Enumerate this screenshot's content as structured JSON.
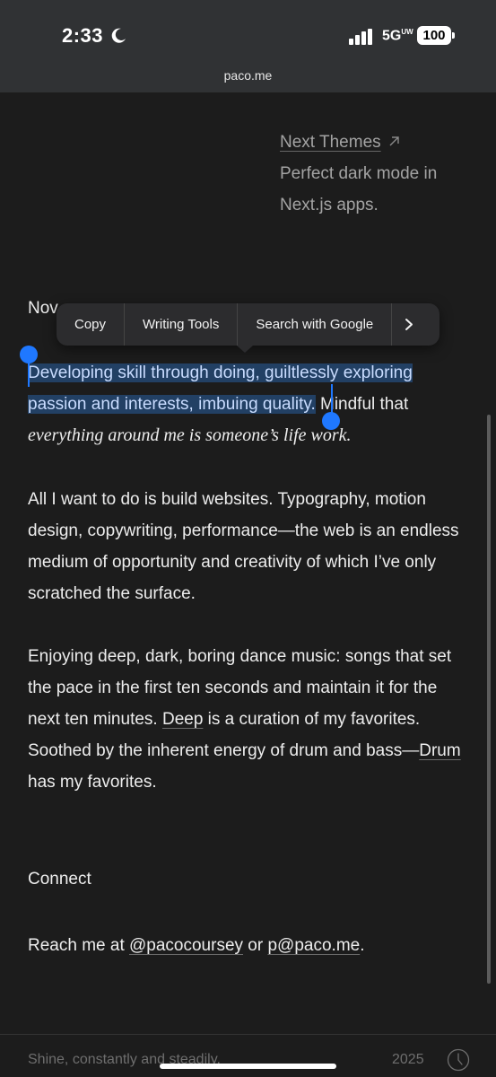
{
  "status_bar": {
    "time": "2:33",
    "network": "5G",
    "network_superscript": "UW",
    "battery": "100"
  },
  "browser": {
    "url": "paco.me"
  },
  "project": {
    "link": "Next Themes",
    "desc_line1": "Perfect dark mode in",
    "desc_line2": "Next.js apps."
  },
  "now": {
    "heading": "Nov",
    "para1": {
      "selected_line1": "Developing skill through doing, guiltlessly exploring",
      "selected_line2": "passion and interests, imbuing quality.",
      "rest_line2": " Mindful that",
      "italic_line3": "everything around me is someone’s life work."
    },
    "para2": "All I want to do is build websites. Typography, motion design, copywriting, performance—the web is an endless medium of opportunity and creativity of which I’ve only scratched the surface.",
    "para3": {
      "text1": "Enjoying deep, dark, boring dance music: songs that set the pace in the first ten seconds and maintain it for the next ten minutes. ",
      "link_deep": "Deep",
      "text2": " is a curation of my favorites. Soothed by the inherent energy of drum and bass—",
      "link_drum": "Drum",
      "text3": " has my favorites."
    }
  },
  "context_menu": {
    "copy": "Copy",
    "writing_tools": "Writing Tools",
    "search_google": "Search with Google",
    "more": "›"
  },
  "connect": {
    "heading": "Connect",
    "text1": "Reach me at ",
    "link_handle": "@pacocoursey",
    "text2": " or ",
    "link_email": "p@paco.me",
    "text3": "."
  },
  "footer": {
    "tagline": "Shine, constantly and steadily.",
    "year": "2025"
  },
  "colors": {
    "background": "#1c1c1c",
    "selection": "#285fa0",
    "handle": "#1f78ff",
    "topbar": "#303234"
  },
  "icons": [
    "moon-icon",
    "cellular-signal-icon",
    "chevron-right-icon",
    "arrow-up-right-icon",
    "clock-icon"
  ]
}
